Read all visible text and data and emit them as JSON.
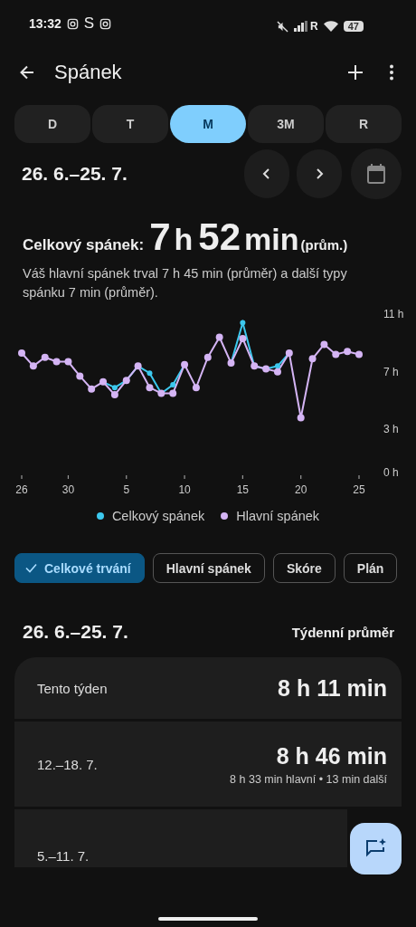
{
  "status_bar": {
    "time": "13:32",
    "app_letter": "S",
    "network_type": "R",
    "battery": "47"
  },
  "app_bar": {
    "title": "Spánek"
  },
  "range_tabs": [
    {
      "label": "D",
      "selected": false
    },
    {
      "label": "T",
      "selected": false
    },
    {
      "label": "M",
      "selected": true
    },
    {
      "label": "3M",
      "selected": false
    },
    {
      "label": "R",
      "selected": false
    }
  ],
  "period": "26. 6.–25. 7.",
  "summary": {
    "label": "Celkový spánek:",
    "hours": "7",
    "hours_unit": "h",
    "minutes": "52",
    "minutes_unit": "min",
    "suffix": "(prům.)",
    "description": "Váš hlavní spánek trval 7 h 45 min (průměr) a další typy spánku 7 min (průměr)."
  },
  "chart_data": {
    "type": "line",
    "categories": [
      "26",
      null,
      null,
      null,
      "30",
      null,
      null,
      null,
      null,
      "5",
      null,
      null,
      null,
      null,
      "10",
      null,
      null,
      null,
      null,
      "15",
      null,
      null,
      null,
      null,
      "20",
      null,
      null,
      null,
      null,
      "25"
    ],
    "yticks": [
      {
        "value": 0,
        "label": "0 h"
      },
      {
        "value": 3,
        "label": "3 h"
      },
      {
        "value": 7,
        "label": "7 h"
      },
      {
        "value": 11,
        "label": "11 h"
      }
    ],
    "ylim": [
      0,
      11
    ],
    "series": [
      {
        "name": "Celkový spánek",
        "color": "#3cc8ee",
        "marker": "circle",
        "values": [
          null,
          null,
          null,
          null,
          null,
          null,
          null,
          6.3,
          5.9,
          6.4,
          7.4,
          6.9,
          5.5,
          6.1,
          7.5,
          null,
          null,
          null,
          7.6,
          10.4,
          7.4,
          7.2,
          7.4,
          8.3,
          null,
          null,
          null,
          null,
          null,
          null
        ]
      },
      {
        "name": "Hlavní spánek",
        "color": "#d4b4f4",
        "marker": "circle",
        "values": [
          8.3,
          7.4,
          8.0,
          7.7,
          7.7,
          6.7,
          5.8,
          6.3,
          5.4,
          6.4,
          7.4,
          5.9,
          5.5,
          5.5,
          7.5,
          5.9,
          8.0,
          9.4,
          7.6,
          9.3,
          7.4,
          7.2,
          7.0,
          8.3,
          3.8,
          7.9,
          8.9,
          8.2,
          8.4,
          8.2
        ]
      }
    ]
  },
  "filter_chips": [
    {
      "label": "Celkové trvání",
      "selected": true
    },
    {
      "label": "Hlavní spánek",
      "selected": false
    },
    {
      "label": "Skóre",
      "selected": false
    },
    {
      "label": "Plán",
      "selected": false
    }
  ],
  "weekly": {
    "period": "26. 6.–25. 7.",
    "heading": "Týdenní průměr",
    "rows": [
      {
        "label": "Tento týden",
        "value": "8 h 11 min"
      },
      {
        "label": "12.–18. 7.",
        "value": "8 h 46 min",
        "detail": "8 h 33 min hlavní • 13 min další"
      },
      {
        "label": "5.–11. 7."
      }
    ]
  }
}
